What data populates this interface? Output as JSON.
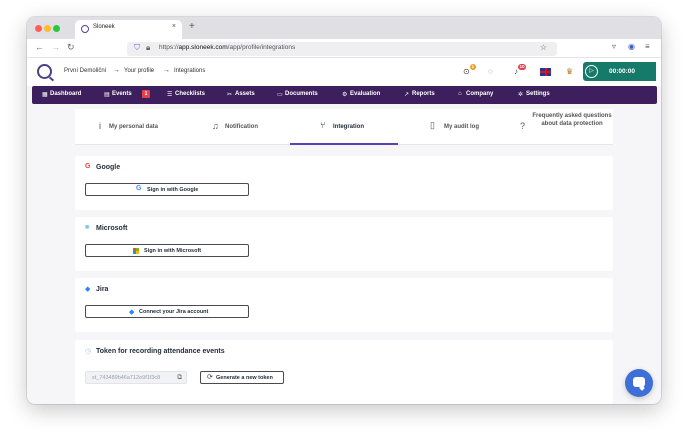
{
  "browser": {
    "tab_title": "Sloneek",
    "tab_close": "×",
    "new_tab": "+",
    "url_prefix": "https://",
    "url_host": "app.sloneek.com",
    "url_path": "/app/profile/integrations"
  },
  "header": {
    "breadcrumbs": [
      "První Demoliční",
      "Your profile",
      "Integrations"
    ],
    "breadcrumb_separator": "→",
    "notification_badges": {
      "history": "1",
      "alerts": "10"
    },
    "timer": "00:00:00"
  },
  "menu": {
    "items": [
      {
        "label": "Dashboard",
        "icon": "grid-icon"
      },
      {
        "label": "Events",
        "icon": "calendar-icon",
        "badge": "1"
      },
      {
        "label": "Checklists",
        "icon": "checklist-icon"
      },
      {
        "label": "Assets",
        "icon": "tools-icon"
      },
      {
        "label": "Documents",
        "icon": "folder-icon"
      },
      {
        "label": "Evaluation",
        "icon": "evaluation-icon"
      },
      {
        "label": "Reports",
        "icon": "chart-icon"
      },
      {
        "label": "Company",
        "icon": "building-icon"
      },
      {
        "label": "Settings",
        "icon": "gear-icon"
      }
    ]
  },
  "profile_tabs": [
    {
      "label": "My personal data",
      "icon": "info-icon"
    },
    {
      "label": "Notification",
      "icon": "bell-icon"
    },
    {
      "label": "Integration",
      "icon": "branch-icon",
      "active": true
    },
    {
      "label": "My audit log",
      "icon": "document-icon"
    },
    {
      "label": "Frequently asked questions about data protection",
      "icon": "question-icon"
    }
  ],
  "integrations": {
    "google": {
      "title": "Google",
      "button": "Sign in with Google"
    },
    "microsoft": {
      "title": "Microsoft",
      "button": "Sign in with Microsoft"
    },
    "jira": {
      "title": "Jira",
      "button": "Connect your Jira account"
    },
    "token": {
      "title": "Token for recording attendance events",
      "value": "st_743489b46a712e9f1f3c8",
      "generate_button": "Generate a new token"
    }
  },
  "colors": {
    "menu_bg": "#3c1f5c",
    "timer_bg": "#167a6a",
    "active_tab_underline": "#5a3fb5",
    "chat_button": "#3e6fd8"
  }
}
